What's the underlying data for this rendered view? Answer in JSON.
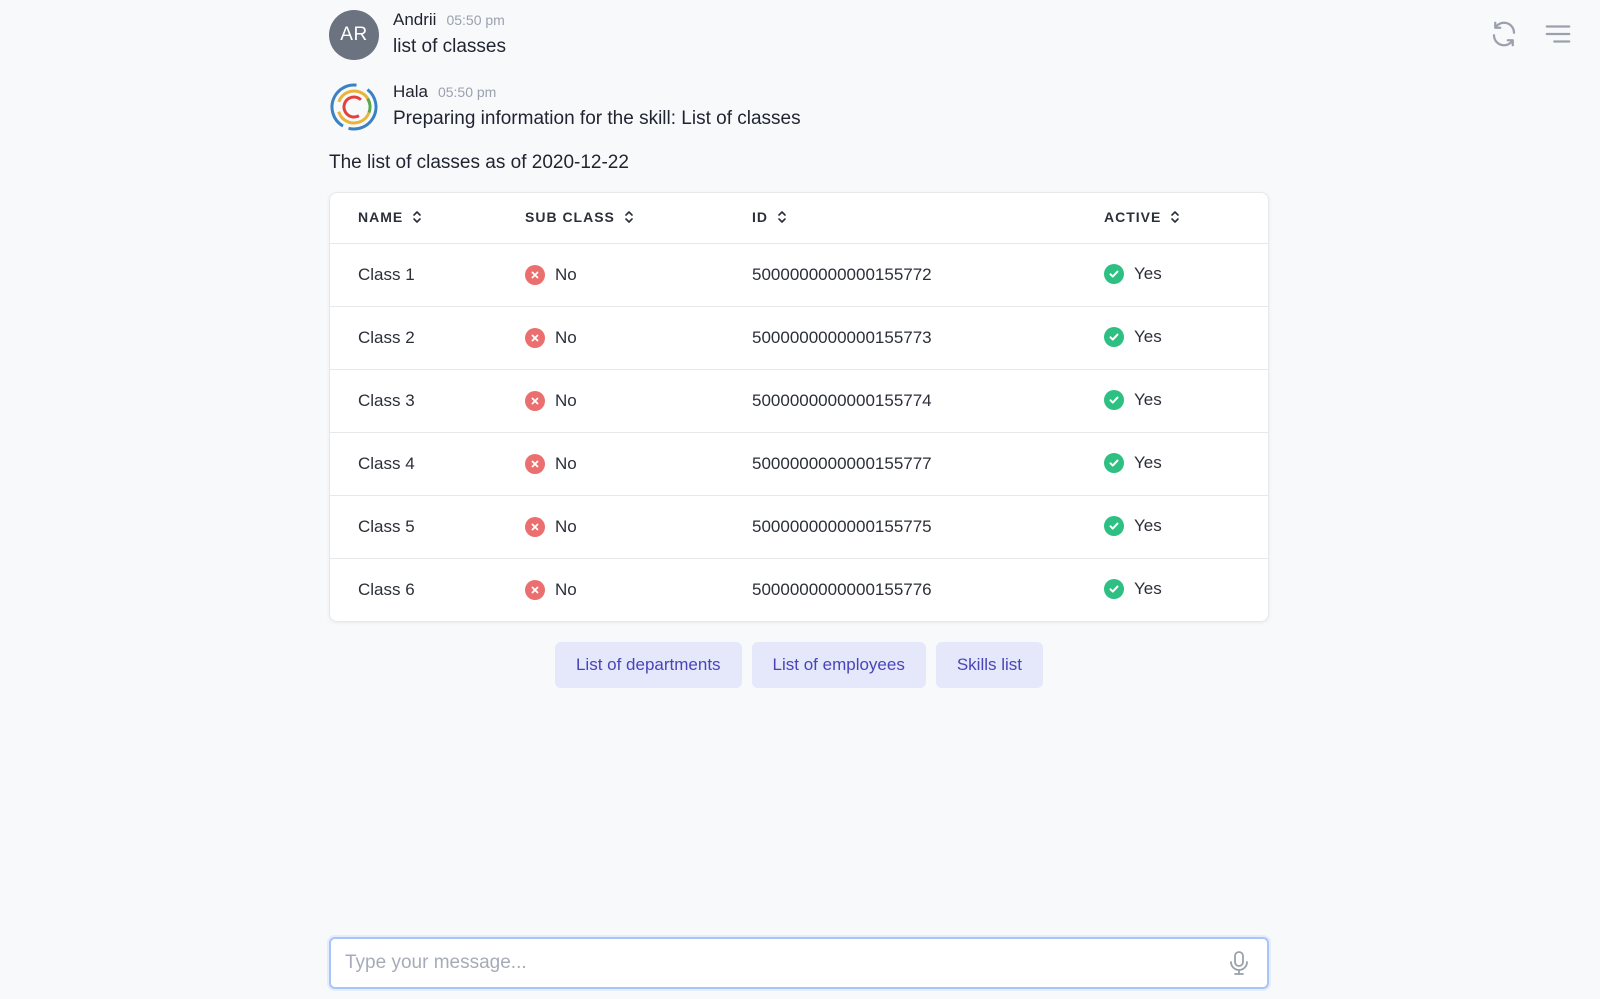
{
  "header": {
    "refresh_icon": "refresh-icon",
    "menu_icon": "hamburger-menu-icon"
  },
  "messages": [
    {
      "author": "Andrii",
      "initials": "AR",
      "time": "05:50 pm",
      "text": "list of classes"
    },
    {
      "author": "Hala",
      "time": "05:50 pm",
      "text": "Preparing information for the skill: List of classes"
    }
  ],
  "intro": "The list of classes as of 2020-12-22",
  "table": {
    "columns": [
      "NAME",
      "SUB CLASS",
      "ID",
      "ACTIVE"
    ],
    "rows": [
      {
        "name": "Class 1",
        "sub_class": "No",
        "id": "5000000000000155772",
        "active": "Yes"
      },
      {
        "name": "Class 2",
        "sub_class": "No",
        "id": "5000000000000155773",
        "active": "Yes"
      },
      {
        "name": "Class 3",
        "sub_class": "No",
        "id": "5000000000000155774",
        "active": "Yes"
      },
      {
        "name": "Class 4",
        "sub_class": "No",
        "id": "5000000000000155777",
        "active": "Yes"
      },
      {
        "name": "Class 5",
        "sub_class": "No",
        "id": "5000000000000155775",
        "active": "Yes"
      },
      {
        "name": "Class 6",
        "sub_class": "No",
        "id": "5000000000000155776",
        "active": "Yes"
      }
    ]
  },
  "suggestions": [
    "List of departments",
    "List of employees",
    "Skills list"
  ],
  "composer": {
    "placeholder": "Type your message...",
    "value": ""
  },
  "colors": {
    "accent": "#4a44b8",
    "chip_bg": "#e5e8fb",
    "status_no": "#ec6f6f",
    "status_yes": "#2ebf82",
    "avatar_bg": "#6b7280"
  }
}
